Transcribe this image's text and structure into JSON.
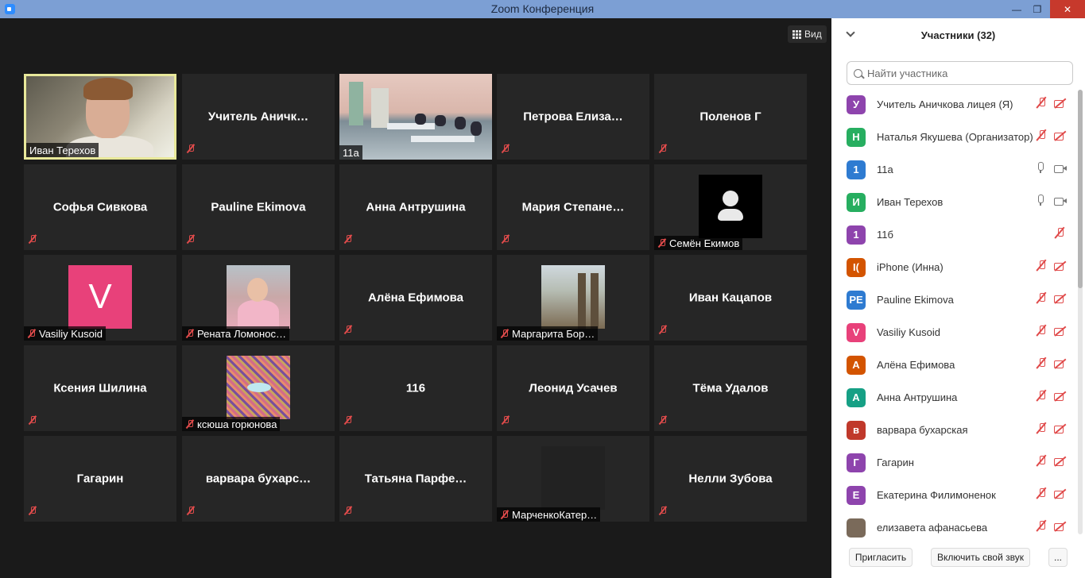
{
  "window": {
    "title": "Zoom Конференция"
  },
  "toolbar": {
    "view_label": "Вид"
  },
  "gallery": {
    "tiles": [
      {
        "name": "Иван Терехов",
        "kind": "face"
      },
      {
        "name": "Учитель  Аничк…",
        "kind": "text"
      },
      {
        "name": "11а",
        "kind": "class"
      },
      {
        "name": "Петрова  Елиза…",
        "kind": "text"
      },
      {
        "name": "Поленов Г",
        "kind": "text"
      },
      {
        "name": "Софья Сивкова",
        "kind": "text"
      },
      {
        "name": "Pauline Ekimova",
        "kind": "text"
      },
      {
        "name": "Анна Антрушина",
        "kind": "text"
      },
      {
        "name": "Мария  Степане…",
        "kind": "text"
      },
      {
        "name": "Семён Екимов",
        "kind": "person"
      },
      {
        "name": "Vasiliy Kusoid",
        "kind": "v",
        "avatar_letter": "V"
      },
      {
        "name": "Рената Ломонос…",
        "kind": "girl"
      },
      {
        "name": "Алёна Ефимова",
        "kind": "text"
      },
      {
        "name": "Маргарита Бор…",
        "kind": "arch"
      },
      {
        "name": "Иван Кацапов",
        "kind": "text"
      },
      {
        "name": "Ксения Шилина",
        "kind": "text"
      },
      {
        "name": "ксюша горюнова",
        "kind": "noise"
      },
      {
        "name": "116",
        "kind": "text"
      },
      {
        "name": "Леонид Усачев",
        "kind": "text"
      },
      {
        "name": "Тёма Удалов",
        "kind": "text"
      },
      {
        "name": "Гагарин",
        "kind": "text"
      },
      {
        "name": "варвара  бухарс…",
        "kind": "text"
      },
      {
        "name": "Татьяна  Парфе…",
        "kind": "text"
      },
      {
        "name": "МарченкоКатер…",
        "kind": "dark"
      },
      {
        "name": "Нелли Зубова",
        "kind": "text"
      }
    ]
  },
  "panel": {
    "title": "Участники (32)",
    "search_placeholder": "Найти участника",
    "participants": [
      {
        "initial": "У",
        "name": "Учитель Аничкова лицея (Я)",
        "color": "#8e44ad",
        "mic": "off",
        "cam": "off"
      },
      {
        "initial": "Н",
        "name": "Наталья Якушева (Организатор)",
        "color": "#27ae60",
        "mic": "off",
        "cam": "off"
      },
      {
        "initial": "1",
        "name": "11а",
        "color": "#2e7bd1",
        "mic": "on",
        "cam": "on"
      },
      {
        "initial": "И",
        "name": "Иван Терехов",
        "color": "#27ae60",
        "mic": "on",
        "cam": "on"
      },
      {
        "initial": "1",
        "name": "11б",
        "color": "#8e44ad",
        "mic": "none",
        "cam": "mic-off-only"
      },
      {
        "initial": "I(",
        "name": "iPhone (Инна)",
        "color": "#d35400",
        "mic": "off",
        "cam": "off"
      },
      {
        "initial": "PE",
        "name": "Pauline Ekimova",
        "color": "#2e7bd1",
        "mic": "off",
        "cam": "off"
      },
      {
        "initial": "V",
        "name": "Vasiliy Kusoid",
        "color": "#e8417a",
        "mic": "off",
        "cam": "off"
      },
      {
        "initial": "А",
        "name": "Алёна Ефимова",
        "color": "#d35400",
        "mic": "off",
        "cam": "off"
      },
      {
        "initial": "А",
        "name": "Анна Антрушина",
        "color": "#16a085",
        "mic": "off",
        "cam": "off"
      },
      {
        "initial": "в",
        "name": "варвара бухарская",
        "color": "#c0392b",
        "mic": "off",
        "cam": "off"
      },
      {
        "initial": "Г",
        "name": "Гагарин",
        "color": "#8e44ad",
        "mic": "off",
        "cam": "off"
      },
      {
        "initial": "Е",
        "name": "Екатерина Филимоненок",
        "color": "#8e44ad",
        "mic": "off",
        "cam": "off"
      },
      {
        "initial": "",
        "name": "елизавета афанасьева",
        "color": "#7a6a5a",
        "mic": "off",
        "cam": "off"
      }
    ],
    "invite_label": "Пригласить",
    "unmute_label": "Включить свой звук",
    "more_label": "..."
  },
  "colors": {
    "active_speaker": "#e8e89a",
    "muted_red": "#e04b4b",
    "title_bar": "#7c9fd4"
  }
}
